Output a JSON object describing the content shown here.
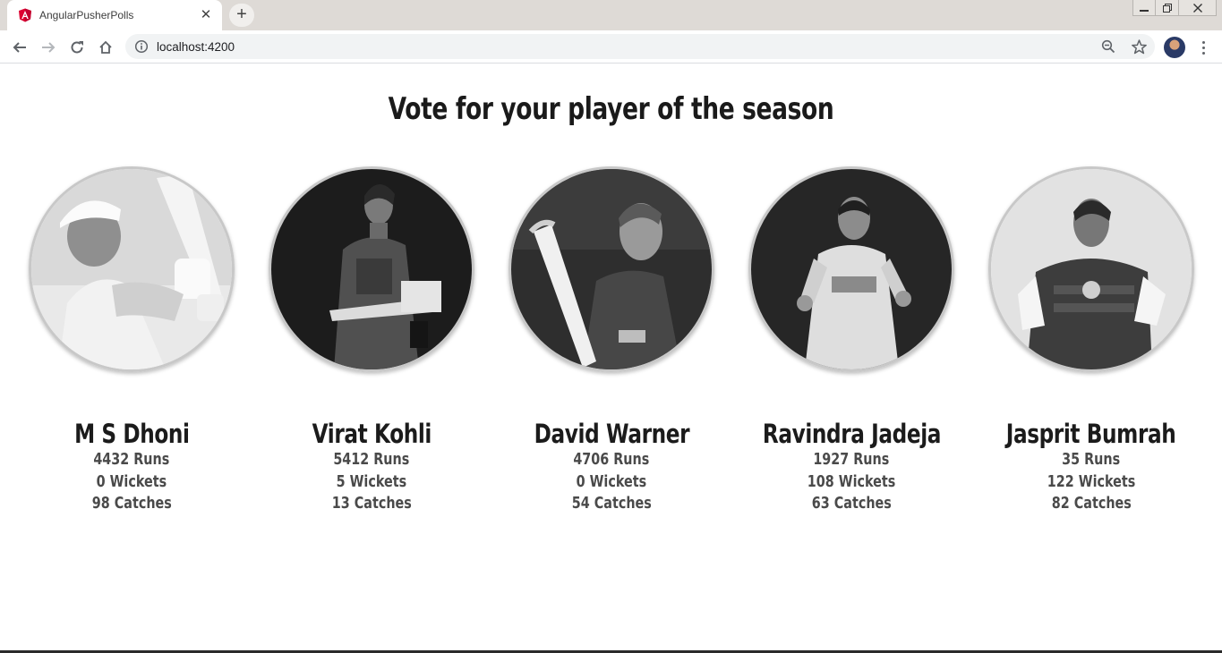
{
  "browser": {
    "tab_title": "AngularPusherPolls",
    "url": "localhost:4200"
  },
  "page": {
    "heading": "Vote for your player of the season",
    "players": [
      {
        "name": "M S Dhoni",
        "runs": "4432 Runs",
        "wickets": "0 Wickets",
        "catches": "98 Catches"
      },
      {
        "name": "Virat Kohli",
        "runs": "5412 Runs",
        "wickets": "5 Wickets",
        "catches": "13 Catches"
      },
      {
        "name": "David Warner",
        "runs": "4706 Runs",
        "wickets": "0 Wickets",
        "catches": "54 Catches"
      },
      {
        "name": "Ravindra Jadeja",
        "runs": "1927 Runs",
        "wickets": "108 Wickets",
        "catches": "63 Catches"
      },
      {
        "name": "Jasprit Bumrah",
        "runs": "35 Runs",
        "wickets": "122 Wickets",
        "catches": "82 Catches"
      }
    ]
  },
  "icons": {
    "favicon": "angular-logo-icon",
    "back": "back-arrow-icon",
    "forward": "forward-arrow-icon",
    "reload": "reload-icon",
    "home": "home-icon",
    "info": "info-icon",
    "zoom": "zoom-out-icon",
    "bookmark": "star-icon",
    "menu": "kebab-menu-icon"
  },
  "colors": {
    "angular_red": "#dd0031",
    "tabstrip": "#dedad6",
    "omnibox": "#f1f3f4"
  }
}
